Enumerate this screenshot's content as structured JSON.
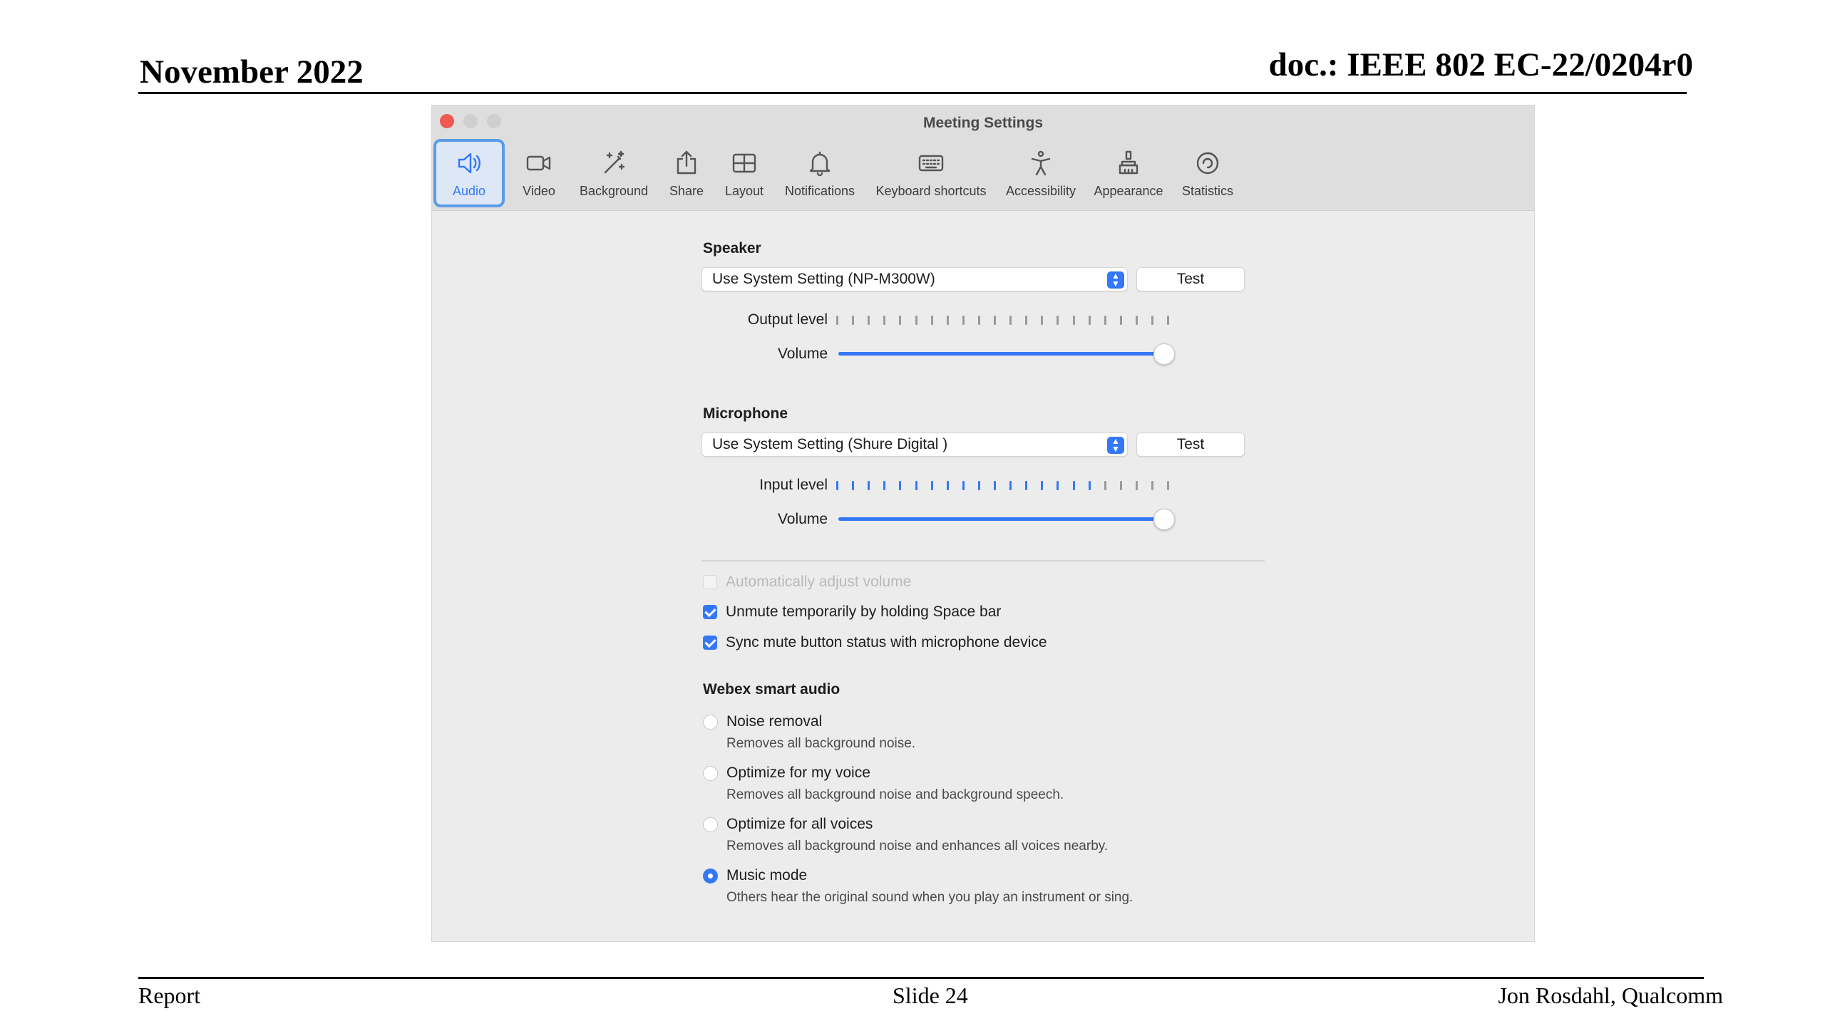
{
  "slide": {
    "header_left": "November 2022",
    "header_right": "doc.: IEEE 802 EC-22/0204r0",
    "footer_left": "Report",
    "footer_center": "Slide 24",
    "footer_right": "Jon Rosdahl, Qualcomm"
  },
  "window": {
    "title": "Meeting Settings",
    "tabs": [
      {
        "label": "Audio",
        "icon": "speaker-icon",
        "active": true
      },
      {
        "label": "Video",
        "icon": "video-camera-icon",
        "active": false
      },
      {
        "label": "Background",
        "icon": "magic-wand-icon",
        "active": false
      },
      {
        "label": "Share",
        "icon": "share-icon",
        "active": false
      },
      {
        "label": "Layout",
        "icon": "layout-icon",
        "active": false
      },
      {
        "label": "Notifications",
        "icon": "bell-icon",
        "active": false
      },
      {
        "label": "Keyboard shortcuts",
        "icon": "keyboard-icon",
        "active": false
      },
      {
        "label": "Accessibility",
        "icon": "accessibility-icon",
        "active": false
      },
      {
        "label": "Appearance",
        "icon": "paint-brush-icon",
        "active": false
      },
      {
        "label": "Statistics",
        "icon": "statistics-icon",
        "active": false
      }
    ]
  },
  "speaker": {
    "title": "Speaker",
    "device": "Use System Setting (NP-M300W)",
    "test_label": "Test",
    "output_label": "Output level",
    "output_level": 0.0,
    "volume_label": "Volume",
    "volume": 1.0
  },
  "microphone": {
    "title": "Microphone",
    "device": "Use System Setting (Shure Digital   )",
    "test_label": "Test",
    "input_label": "Input level",
    "input_level": 0.77,
    "volume_label": "Volume",
    "volume": 1.0
  },
  "options": {
    "auto_adjust": {
      "label": "Automatically adjust volume",
      "checked": false,
      "disabled": true
    },
    "unmute_space": {
      "label": "Unmute temporarily by holding Space bar",
      "checked": true
    },
    "sync_mute": {
      "label": "Sync mute button status with microphone device",
      "checked": true
    }
  },
  "smart_audio": {
    "title": "Webex smart audio",
    "modes": [
      {
        "label": "Noise removal",
        "desc": "Removes all background noise.",
        "selected": false
      },
      {
        "label": "Optimize for my voice",
        "desc": "Removes all background noise and background speech.",
        "selected": false
      },
      {
        "label": "Optimize for all voices",
        "desc": "Removes all background noise and enhances all voices nearby.",
        "selected": false
      },
      {
        "label": "Music mode",
        "desc": "Others hear the original sound when you play an instrument or sing.",
        "selected": true
      }
    ]
  },
  "colors": {
    "accent": "#3478f6",
    "tick_inactive": "#9a9a9a",
    "close_button": "#ee5a52"
  }
}
